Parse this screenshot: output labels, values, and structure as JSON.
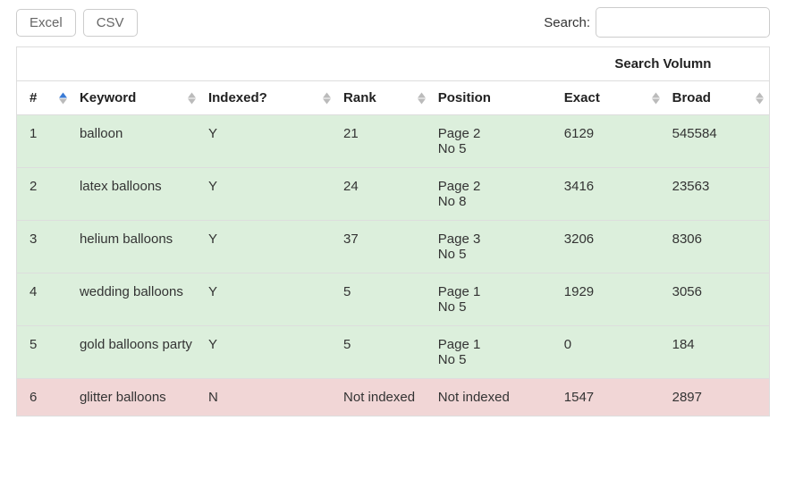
{
  "toolbar": {
    "excel": "Excel",
    "csv": "CSV",
    "search_label": "Search:",
    "search_value": ""
  },
  "table": {
    "group_header": "Search Volumn",
    "headers": {
      "num": "#",
      "keyword": "Keyword",
      "indexed": "Indexed?",
      "rank": "Rank",
      "position": "Position",
      "exact": "Exact",
      "broad": "Broad"
    },
    "rows": [
      {
        "num": "1",
        "keyword": "balloon",
        "indexed": "Y",
        "rank": "21",
        "pos1": "Page 2",
        "pos2": "No 5",
        "exact": "6129",
        "broad": "545584"
      },
      {
        "num": "2",
        "keyword": "latex balloons",
        "indexed": "Y",
        "rank": "24",
        "pos1": "Page 2",
        "pos2": "No 8",
        "exact": "3416",
        "broad": "23563"
      },
      {
        "num": "3",
        "keyword": "helium balloons",
        "indexed": "Y",
        "rank": "37",
        "pos1": "Page 3",
        "pos2": "No 5",
        "exact": "3206",
        "broad": "8306"
      },
      {
        "num": "4",
        "keyword": "wedding balloons",
        "indexed": "Y",
        "rank": "5",
        "pos1": "Page 1",
        "pos2": "No 5",
        "exact": "1929",
        "broad": "3056"
      },
      {
        "num": "5",
        "keyword": "gold balloons party",
        "indexed": "Y",
        "rank": "5",
        "pos1": "Page 1",
        "pos2": "No 5",
        "exact": "0",
        "broad": "184"
      },
      {
        "num": "6",
        "keyword": "glitter balloons",
        "indexed": "N",
        "rank": "Not indexed",
        "pos1": "Not indexed",
        "pos2": "",
        "exact": "1547",
        "broad": "2897"
      }
    ]
  }
}
